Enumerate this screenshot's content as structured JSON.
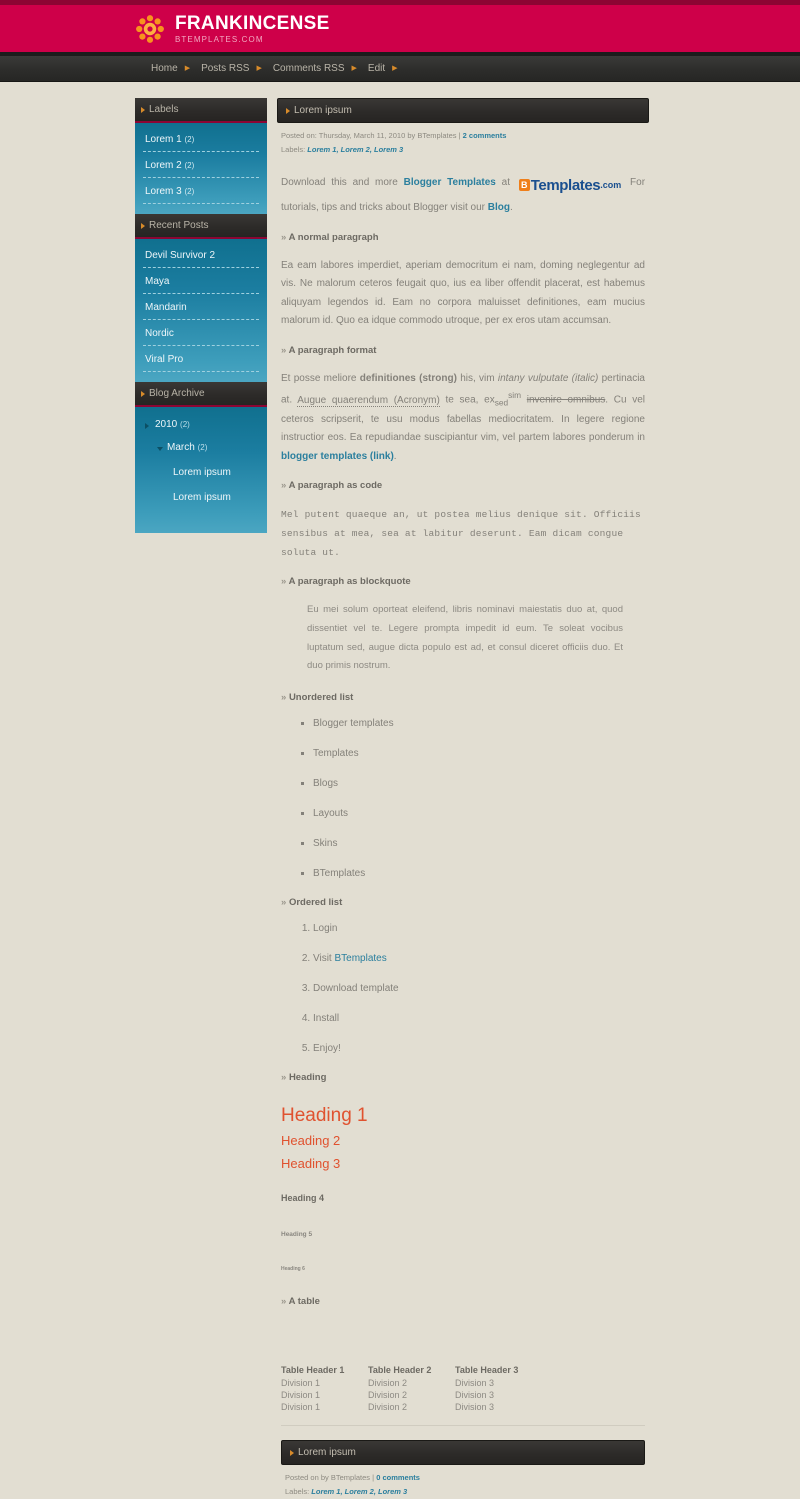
{
  "header": {
    "site_title": "FRANKINCENSE",
    "site_subtitle": "BTEMPLATES.COM",
    "logo_icon": "flower-sunburst-icon",
    "bg_color": "#ce0049"
  },
  "nav": {
    "items": [
      {
        "label": "Home"
      },
      {
        "label": "Posts RSS"
      },
      {
        "label": "Comments RSS"
      },
      {
        "label": "Edit"
      }
    ],
    "separator_icon": "arrow-right-icon"
  },
  "sidebar": {
    "widgets": [
      {
        "title": "Labels",
        "type": "labels",
        "items": [
          {
            "label": "Lorem 1",
            "count": "(2)"
          },
          {
            "label": "Lorem 2",
            "count": "(2)"
          },
          {
            "label": "Lorem 3",
            "count": "(2)"
          }
        ]
      },
      {
        "title": "Recent Posts",
        "type": "recent",
        "items": [
          {
            "label": "Devil Survivor 2"
          },
          {
            "label": "Maya"
          },
          {
            "label": "Mandarin"
          },
          {
            "label": "Nordic"
          },
          {
            "label": "Viral Pro"
          }
        ]
      },
      {
        "title": "Blog Archive",
        "type": "archive",
        "year": {
          "label": "2010",
          "count": "(2)"
        },
        "month": {
          "label": "March",
          "count": "(2)"
        },
        "posts": [
          {
            "label": "Lorem ipsum"
          },
          {
            "label": "Lorem ipsum"
          }
        ]
      }
    ]
  },
  "post": {
    "title": "Lorem ipsum",
    "meta_prefix": "Posted on: Thursday, March 11, 2010 by BTemplates |",
    "comments_link": "2 comments",
    "labels_prefix": "Labels:",
    "labels": [
      "Lorem 1,",
      "Lorem 2,",
      "Lorem 3"
    ],
    "intro": {
      "before": "Download this and more",
      "link1": "Blogger Templates",
      "at": "at",
      "logo_b": "B",
      "logo_templates": "Templates",
      "logo_com": ".com",
      "after": "For tutorials, tips and tricks about Blogger visit our",
      "link2": "Blog",
      "period": "."
    },
    "sections": [
      {
        "heading": "A normal paragraph"
      },
      {
        "heading": "A paragraph format"
      },
      {
        "heading": "A paragraph as code"
      },
      {
        "heading": "A paragraph as blockquote"
      },
      {
        "heading": "Unordered list"
      },
      {
        "heading": "Ordered list"
      },
      {
        "heading": "Heading"
      },
      {
        "heading": "A table"
      }
    ],
    "normal_paragraph": "Ea eam labores imperdiet, aperiam democritum ei nam, doming neglegentur ad vis. Ne malorum ceteros feugait quo, ius ea liber offendit placerat, est habemus aliquyam legendos id. Eam no corpora maluisset definitiones, eam mucius malorum id. Quo ea idque commodo utroque, per ex eros utam accumsan.",
    "format_paragraph": {
      "p1": "Et posse meliore",
      "strong": "definitiones (strong)",
      "p2": "his, vim",
      "italic": "intany vulputate (italic)",
      "p3": "pertinacia at.",
      "acronym": "Augue quaerendum (Acronym)",
      "p4": "te sea, ex",
      "sub": "sed",
      "sup": "sim",
      "strike": "invenire omnibus",
      "p5": ". Cu vel ceteros scripserit, te usu modus fabellas mediocritatem. In legere regione instructior eos. Ea repudiandae suscipiantur vim, vel partem labores ponderum in",
      "link": "blogger templates (link)",
      "p6": "."
    },
    "code_paragraph": "Mel putent quaeque an, ut postea melius denique sit. Officiis sensibus at mea, sea at labitur deserunt. Eam dicam congue soluta ut.",
    "blockquote": "Eu mei solum oporteat eleifend, libris nominavi maiestatis duo at, quod dissentiet vel te. Legere prompta impedit id eum. Te soleat vocibus luptatum sed, augue dicta populo est ad, et consul diceret officiis duo. Et duo primis nostrum.",
    "unordered_list": [
      "Blogger templates",
      "Templates",
      "Blogs",
      "Layouts",
      "Skins",
      "BTemplates"
    ],
    "ordered_list": [
      {
        "text": "Login",
        "link": ""
      },
      {
        "text": "Visit ",
        "link": "BTemplates"
      },
      {
        "text": "Download template",
        "link": ""
      },
      {
        "text": "Install",
        "link": ""
      },
      {
        "text": "Enjoy!",
        "link": ""
      }
    ],
    "headings": {
      "h1": "Heading 1",
      "h2": "Heading 2",
      "h3": "Heading 3",
      "h4": "Heading 4",
      "h5": "Heading 5",
      "h6": "Heading 6"
    },
    "table": {
      "headers": [
        "Table Header 1",
        "Table Header 2",
        "Table Header 3"
      ],
      "rows": [
        [
          "Division 1",
          "Division 2",
          "Division 3"
        ],
        [
          "Division 1",
          "Division 2",
          "Division 3"
        ],
        [
          "Division 1",
          "Division 2",
          "Division 3"
        ]
      ]
    }
  },
  "post2": {
    "title": "Lorem ipsum",
    "meta_prefix": "Posted on by BTemplates |",
    "comments_link": "0 comments",
    "labels_prefix": "Labels:",
    "labels": [
      "Lorem 1,",
      "Lorem 2,",
      "Lorem 3"
    ]
  },
  "colors": {
    "brand_pink": "#ce0049",
    "dark_bar": "#2d2b29",
    "teal": "#1b7da0",
    "accent_orange": "#d88b2a",
    "heading_orange": "#e0522f",
    "link_blue": "#2b7f9e",
    "page_bg": "#e2ded2"
  }
}
